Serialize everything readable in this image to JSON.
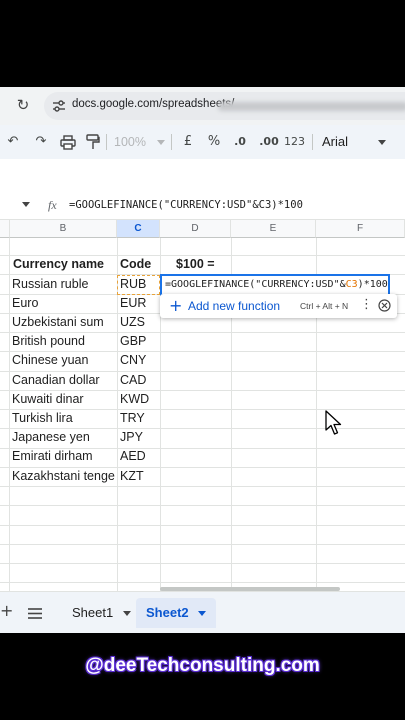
{
  "browser": {
    "url": "docs.google.com/spreadsheets/"
  },
  "toolbar": {
    "zoom": "100%",
    "currency": "£",
    "percent": "%",
    "decimal_decrease": ".0",
    "decimal_increase": ".00",
    "format_123": "123",
    "font": "Arial"
  },
  "formula_bar": {
    "fx": "fx",
    "formula": "=GOOGLEFINANCE(\"CURRENCY:USD\"&C3)*100"
  },
  "columns": [
    "B",
    "C",
    "D",
    "E",
    "F"
  ],
  "headers": {
    "name": "Currency name",
    "code": "Code",
    "amount": "$100 ="
  },
  "rows": [
    {
      "name": "Russian ruble",
      "code": "RUB"
    },
    {
      "name": "Euro",
      "code": "EUR"
    },
    {
      "name": "Uzbekistani sum",
      "code": "UZS"
    },
    {
      "name": "British pound",
      "code": "GBP"
    },
    {
      "name": "Chinese yuan",
      "code": "CNY"
    },
    {
      "name": "Canadian dollar",
      "code": "CAD"
    },
    {
      "name": "Kuwaiti dinar",
      "code": "KWD"
    },
    {
      "name": "Turkish lira",
      "code": "TRY"
    },
    {
      "name": "Japanese yen",
      "code": "JPY"
    },
    {
      "name": "Emirati dirham",
      "code": "AED"
    },
    {
      "name": "Kazakhstani tenge",
      "code": "KZT"
    }
  ],
  "edit_cell": {
    "part1": "=GOOGLEFINANCE(\"CURRENCY:USD\"&",
    "ref": "C3",
    "part2": ")*100"
  },
  "suggestion": {
    "label": "Add new function",
    "shortcut": "Ctrl + Alt + N"
  },
  "sheets": {
    "tab1": "Sheet1",
    "tab2": "Sheet2"
  },
  "watermark": "@deeTechconsulting.com",
  "colors": {
    "accent": "#0b57d0",
    "edit_border": "#1a73e8",
    "active_dashed": "#e8a33a",
    "cell_ref": "#e37400"
  }
}
